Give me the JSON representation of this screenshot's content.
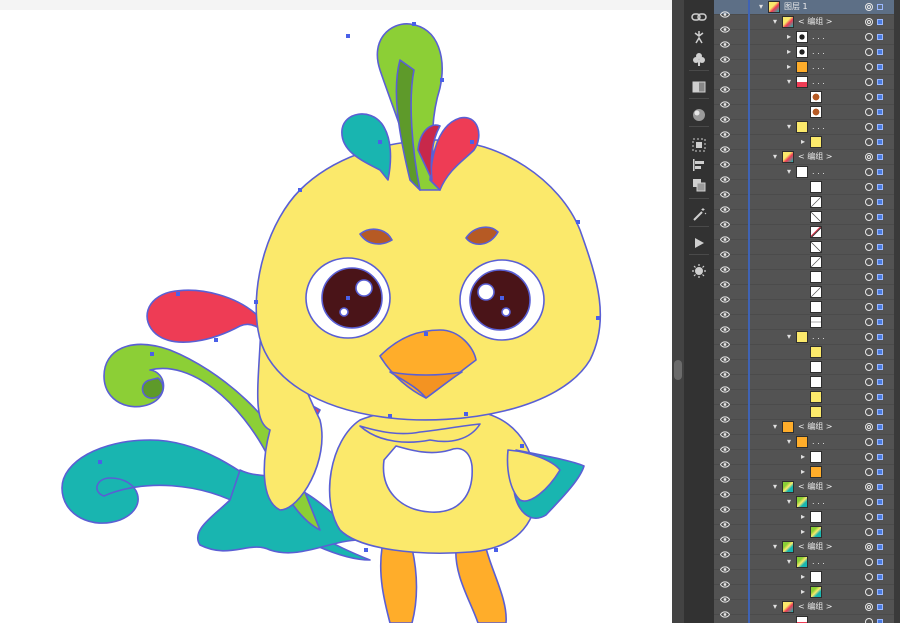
{
  "app": {
    "accent": "#3f63b5",
    "panel_bg": "#535353"
  },
  "artwork": {
    "name": "cartoon-rooster-chick",
    "colors": {
      "body": "#fbe96b",
      "outline": "#5a5fd4",
      "red": "#ee3c55",
      "green": "#8ccf36",
      "teal": "#19b5b0",
      "orange": "#ffad2a",
      "brown": "#b65a24"
    }
  },
  "toolstrip": {
    "tools": [
      "link-icon",
      "puppet-icon",
      "club-icon",
      "gradient-icon",
      "sphere-icon",
      "align-icon",
      "align-left-icon",
      "pathfinder-icon",
      "magic-wand-icon",
      "play-icon",
      "starburst-icon"
    ]
  },
  "layers": {
    "rows": [
      {
        "level": 0,
        "expand": "down",
        "thumb": "chick",
        "label": "图层 1",
        "selected": true,
        "target": "dbl",
        "selbox": "empty"
      },
      {
        "level": 1,
        "expand": "down",
        "thumb": "chick",
        "label": "< 编组 >",
        "target": "dbl"
      },
      {
        "level": 2,
        "expand": "right",
        "thumb": "black",
        "label": ". . .",
        "target": "single"
      },
      {
        "level": 2,
        "expand": "right",
        "thumb": "black",
        "label": ". . .",
        "target": "single"
      },
      {
        "level": 2,
        "expand": "right",
        "thumb": "orange",
        "label": ". . .",
        "target": "single"
      },
      {
        "level": 2,
        "expand": "down",
        "thumb": "red",
        "label": ". . .",
        "target": "single"
      },
      {
        "level": 3,
        "expand": "",
        "thumb": "brown",
        "label": "",
        "target": "single"
      },
      {
        "level": 3,
        "expand": "",
        "thumb": "brown",
        "label": "",
        "target": "single"
      },
      {
        "level": 2,
        "expand": "down",
        "thumb": "yellow",
        "label": ". . .",
        "target": "single"
      },
      {
        "level": 3,
        "expand": "right",
        "thumb": "yellow",
        "label": "",
        "target": "single"
      },
      {
        "level": 1,
        "expand": "down",
        "thumb": "chick",
        "label": "< 编组 >",
        "target": "dbl"
      },
      {
        "level": 2,
        "expand": "down",
        "thumb": "white",
        "label": ". . .",
        "target": "single"
      },
      {
        "level": 3,
        "expand": "",
        "thumb": "white",
        "label": "",
        "target": "single"
      },
      {
        "level": 3,
        "expand": "",
        "thumb": "line",
        "label": "",
        "target": "single"
      },
      {
        "level": 3,
        "expand": "",
        "thumb": "curve",
        "label": "",
        "target": "single"
      },
      {
        "level": 3,
        "expand": "",
        "thumb": "redline",
        "label": "",
        "target": "single"
      },
      {
        "level": 3,
        "expand": "",
        "thumb": "curve",
        "label": "",
        "target": "single"
      },
      {
        "level": 3,
        "expand": "",
        "thumb": "line",
        "label": "",
        "target": "single"
      },
      {
        "level": 3,
        "expand": "",
        "thumb": "white",
        "label": "",
        "target": "single"
      },
      {
        "level": 3,
        "expand": "",
        "thumb": "line",
        "label": "",
        "target": "single"
      },
      {
        "level": 3,
        "expand": "",
        "thumb": "white",
        "label": "",
        "target": "single"
      },
      {
        "level": 3,
        "expand": "",
        "thumb": "dash",
        "label": "",
        "target": "single"
      },
      {
        "level": 2,
        "expand": "down",
        "thumb": "yellow",
        "label": ". . .",
        "target": "single"
      },
      {
        "level": 3,
        "expand": "",
        "thumb": "yellow",
        "label": "",
        "target": "single"
      },
      {
        "level": 3,
        "expand": "",
        "thumb": "white",
        "label": "",
        "target": "single"
      },
      {
        "level": 3,
        "expand": "",
        "thumb": "white",
        "label": "",
        "target": "single"
      },
      {
        "level": 3,
        "expand": "",
        "thumb": "yellow",
        "label": "",
        "target": "single"
      },
      {
        "level": 3,
        "expand": "",
        "thumb": "yellow",
        "label": "",
        "target": "single"
      },
      {
        "level": 1,
        "expand": "down",
        "thumb": "orange",
        "label": "< 编组 >",
        "target": "dbl"
      },
      {
        "level": 2,
        "expand": "down",
        "thumb": "orange",
        "label": ". . .",
        "target": "single"
      },
      {
        "level": 3,
        "expand": "right",
        "thumb": "white",
        "label": "",
        "target": "single"
      },
      {
        "level": 3,
        "expand": "right",
        "thumb": "orange",
        "label": "",
        "target": "single"
      },
      {
        "level": 1,
        "expand": "down",
        "thumb": "mixed",
        "label": "< 编组 >",
        "target": "dbl"
      },
      {
        "level": 2,
        "expand": "down",
        "thumb": "mixed",
        "label": ". . .",
        "target": "single"
      },
      {
        "level": 3,
        "expand": "right",
        "thumb": "white",
        "label": "",
        "target": "single"
      },
      {
        "level": 3,
        "expand": "right",
        "thumb": "mixed",
        "label": "",
        "target": "single"
      },
      {
        "level": 1,
        "expand": "down",
        "thumb": "mixed",
        "label": "< 编组 >",
        "target": "dbl"
      },
      {
        "level": 2,
        "expand": "down",
        "thumb": "mixed",
        "label": ". . .",
        "target": "single"
      },
      {
        "level": 3,
        "expand": "right",
        "thumb": "white",
        "label": "",
        "target": "single"
      },
      {
        "level": 3,
        "expand": "right",
        "thumb": "mixed",
        "label": "",
        "target": "single"
      },
      {
        "level": 1,
        "expand": "down",
        "thumb": "chick",
        "label": "< 编组 >",
        "target": "dbl"
      },
      {
        "level": 2,
        "expand": "",
        "thumb": "red",
        "label": "",
        "target": "single"
      }
    ]
  }
}
